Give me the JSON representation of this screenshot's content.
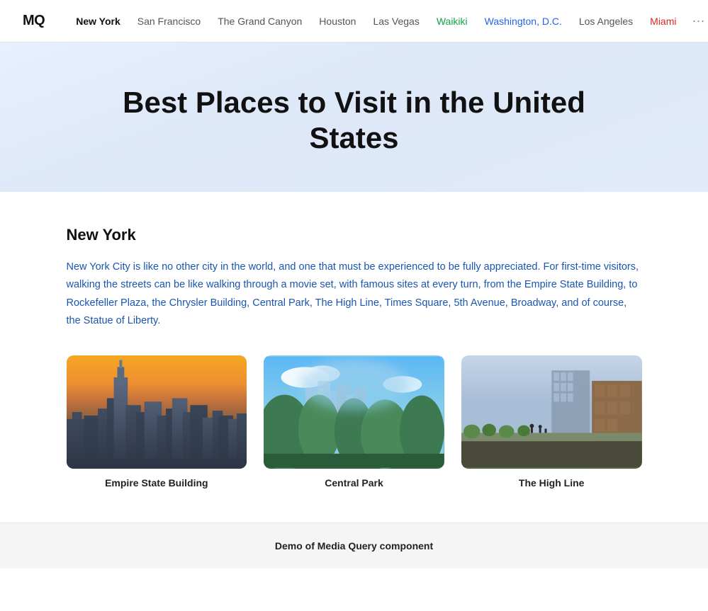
{
  "logo": "MQ",
  "nav": {
    "items": [
      {
        "label": "New York",
        "active": true,
        "color": "active"
      },
      {
        "label": "San Francisco",
        "active": false,
        "color": ""
      },
      {
        "label": "The Grand Canyon",
        "active": false,
        "color": ""
      },
      {
        "label": "Houston",
        "active": false,
        "color": ""
      },
      {
        "label": "Las Vegas",
        "active": false,
        "color": ""
      },
      {
        "label": "Waikiki",
        "active": false,
        "color": "waikiki"
      },
      {
        "label": "Washington, D.C.",
        "active": false,
        "color": "washington"
      },
      {
        "label": "Los Angeles",
        "active": false,
        "color": ""
      },
      {
        "label": "Miami",
        "active": false,
        "color": "miami"
      }
    ],
    "more_label": "···"
  },
  "hero": {
    "title": "Best Places to Visit in the United States"
  },
  "section": {
    "title": "New York",
    "description": "New York City is like no other city in the world, and one that must be experienced to be fully appreciated. For first-time visitors, walking the streets can be like walking through a movie set, with famous sites at every turn, from the Empire State Building, to Rockefeller Plaza, the Chrysler Building, Central Park, The High Line, Times Square, 5th Avenue, Broadway, and of course, the Statue of Liberty.",
    "images": [
      {
        "caption": "Empire State Building",
        "id": "esb"
      },
      {
        "caption": "Central Park",
        "id": "cp"
      },
      {
        "caption": "The High Line",
        "id": "hl"
      }
    ]
  },
  "footer": {
    "label": "Demo of Media Query component"
  }
}
